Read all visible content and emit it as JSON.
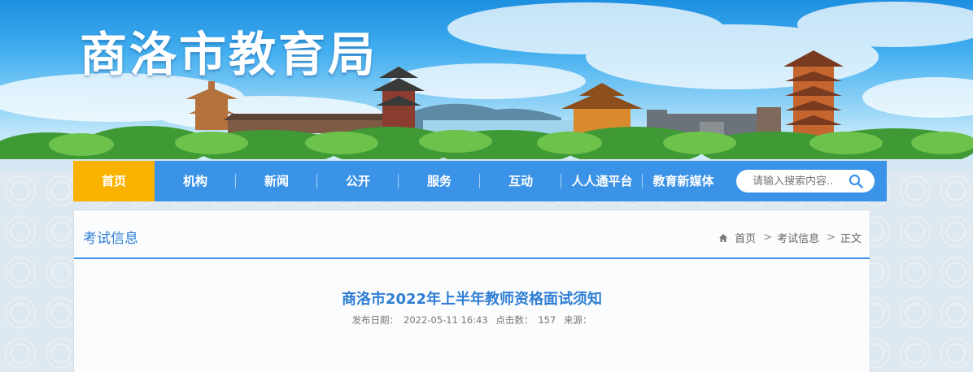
{
  "site": {
    "title": "商洛市教育局"
  },
  "nav": {
    "items": [
      {
        "label": "首页"
      },
      {
        "label": "机构"
      },
      {
        "label": "新闻"
      },
      {
        "label": "公开"
      },
      {
        "label": "服务"
      },
      {
        "label": "互动"
      },
      {
        "label": "人人通平台"
      },
      {
        "label": "教育新媒体"
      }
    ],
    "active_index": 0,
    "search": {
      "placeholder": "请输入搜索内容.."
    }
  },
  "section": {
    "title": "考试信息"
  },
  "breadcrumb": {
    "home": "首页",
    "sep1": ">",
    "category": "考试信息",
    "sep2": ">",
    "current": "正文"
  },
  "article": {
    "title": "商洛市2022年上半年教师资格面试须知",
    "publish_label": "发布日期：",
    "publish_date": "2022-05-11 16:43",
    "hits_label": "点击数：",
    "hits": "157",
    "source_label": "来源："
  },
  "colors": {
    "nav_bg": "#3b93e8",
    "nav_active": "#f9b200",
    "title_blue": "#2f7ed4"
  },
  "icons": {
    "search": "search-icon",
    "home": "home-icon"
  }
}
